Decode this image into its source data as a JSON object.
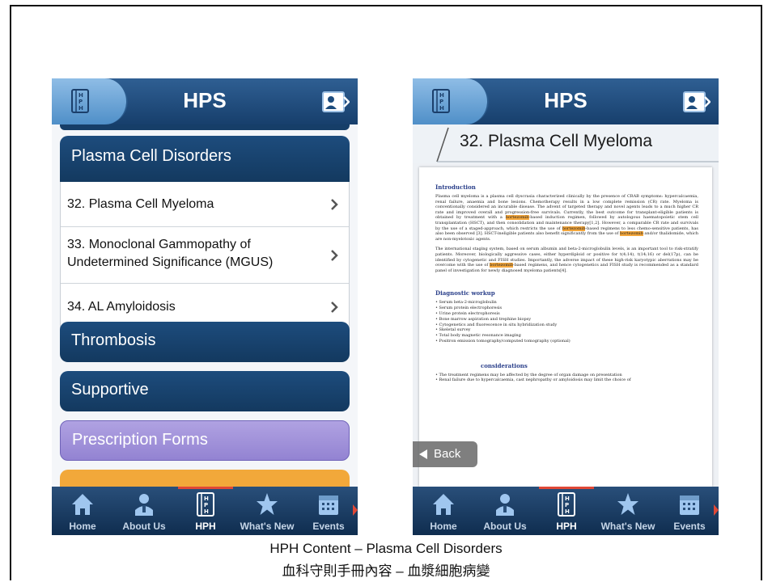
{
  "app_title": "HPS",
  "left_screen": {
    "section_header": "Plasma Cell Disorders",
    "items": [
      {
        "label": "32. Plasma Cell Myeloma"
      },
      {
        "label": "33. Monoclonal Gammopathy of Undetermined Significance (MGUS)"
      },
      {
        "label": "34. AL Amyloidosis"
      }
    ],
    "other_sections": [
      {
        "label": "Thrombosis"
      },
      {
        "label": "Supportive"
      },
      {
        "label": "Prescription Forms"
      }
    ]
  },
  "right_screen": {
    "page_title": "32. Plasma Cell Myeloma",
    "back_label": "Back",
    "document": {
      "intro_heading": "Introduction",
      "intro_p1_a": "Plasma cell myeloma is a plasma cell dyscrasia characterized clinically by the presence of CRAB symptoms: hypercalcaemia, renal failure, anaemia and bone lesions. Chemotherapy results in a low complete remission (CR) rate. Myeloma is conventionally considered an incurable disease. The advent of targeted therapy and novel agents leads to a much higher CR rate and improved overall and progression-free survivals. Currently, the best outcome for transplant-eligible patients is obtained by treatment with a ",
      "intro_p1_b": "-based induction regimen, followed by autologous haematopoietic stem cell transplantation (HSCT), and then consolidation and maintenance therapy[1,2]. However, a comparable CR rate and survivals by the use of a staged-approach, which restricts the use of ",
      "intro_p1_c": "-based regimens to less chemo-sensitive patients, has also been observed [3]. HSCT-ineligible patients also benefit significantly from the use of ",
      "intro_p1_d": " and/or thalidomide, which are non-myelotoxic agents.",
      "intro_p2_a": "The international staging system, based on serum albumin and beta-2-microglobulin levels, is an important tool to risk-stratify patients. Moreover, biologically aggressive cases, either hyperdiploid or positive for t(4;14), t(14;16) or del(17p), can be identified by cytogenetic and FISH studies. Importantly, the adverse impact of these high-risk karyotypic aberrations may be overcome with the use of ",
      "intro_p2_b": "-based regimens, and hence cytogenetics and FISH study is recommended as a standard panel of investigation for newly diagnosed myeloma patients[4].",
      "highlight_term": "bortezomib",
      "workup_heading": "Diagnostic workup",
      "workup_items": [
        "Serum beta-2-microglobulin",
        "Serum protein electrophoresis",
        "Urine protein electrophoresis",
        "Bone marrow aspiration and trephine biopsy",
        "Cytogenetics and fluorescence in situ hybridization study",
        "Skeletal survey",
        "Total body magnetic resonance imaging",
        "Positron emission tomography/computed tomography (optional)"
      ],
      "considerations_heading": "considerations",
      "considerations_items": [
        "The treatment regimens may be affected by the degree of organ damage on presentation",
        "Renal failure due to hypercalcaemia, cast nephropathy or amyloidosis may limit the choice of"
      ]
    }
  },
  "tab_bar": {
    "tabs": [
      {
        "label": "Home",
        "icon": "home-icon"
      },
      {
        "label": "About Us",
        "icon": "person-icon"
      },
      {
        "label": "HPH",
        "icon": "hph-book-icon"
      },
      {
        "label": "What's New",
        "icon": "star-icon"
      },
      {
        "label": "Events",
        "icon": "calendar-icon"
      }
    ],
    "active": "HPH"
  },
  "caption": {
    "line1": "HPH Content – Plasma Cell Disorders",
    "line2": "血科守則手冊內容 – 血漿細胞病變"
  },
  "colors": {
    "header_navy": "#173f6c",
    "section_navy": "#13395f",
    "prescription_purple": "#a08fd8",
    "highlight_orange": "#f4a73c",
    "active_tab_accent": "#e04836"
  }
}
